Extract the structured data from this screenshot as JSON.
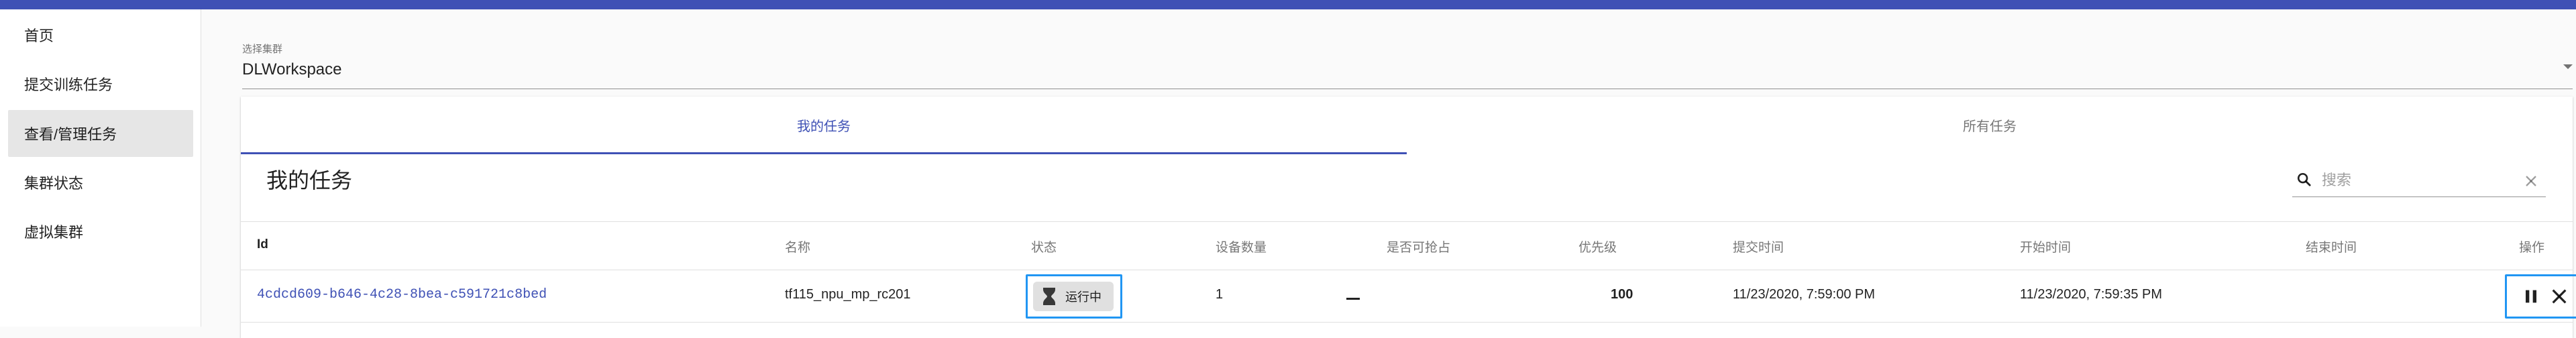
{
  "sidebar": {
    "items": [
      {
        "label": "首页"
      },
      {
        "label": "提交训练任务"
      },
      {
        "label": "查看/管理任务"
      },
      {
        "label": "集群状态"
      },
      {
        "label": "虚拟集群"
      }
    ],
    "active_index": 2
  },
  "cluster_select": {
    "label": "选择集群",
    "value": "DLWorkspace"
  },
  "tabs": [
    {
      "label": "我的任务"
    },
    {
      "label": "所有任务"
    }
  ],
  "card": {
    "title": "我的任务"
  },
  "search": {
    "placeholder": "搜索",
    "value": ""
  },
  "table": {
    "columns": [
      "Id",
      "名称",
      "状态",
      "设备数量",
      "是否可抢占",
      "优先级",
      "提交时间",
      "开始时间",
      "结束时间",
      "操作"
    ],
    "rows": [
      {
        "id": "4cdcd609-b646-4c28-8bea-c591721c8bed",
        "name": "tf115_npu_mp_rc201",
        "status": "运行中",
        "device_count": "1",
        "preemptible": "—",
        "priority": "100",
        "submit_time": "11/23/2020, 7:59:00 PM",
        "start_time": "11/23/2020, 7:59:35 PM",
        "end_time": ""
      }
    ]
  },
  "colors": {
    "primary": "#3f51b5",
    "highlight": "#2196f3"
  },
  "icons": {
    "search": "search-icon",
    "clear": "close-icon",
    "status": "hourglass-icon",
    "pause": "pause-icon",
    "kill": "close-icon",
    "help": "help-icon"
  }
}
